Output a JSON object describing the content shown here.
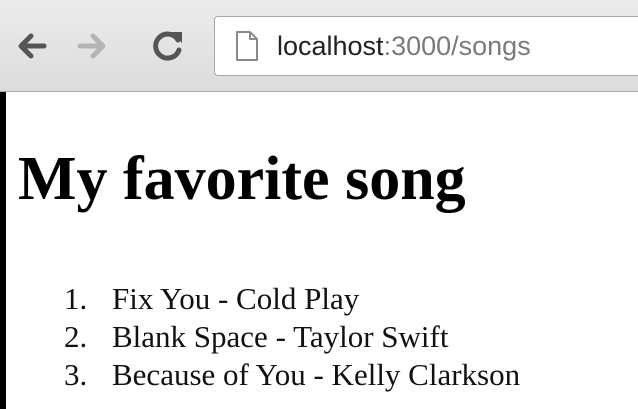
{
  "browser": {
    "url_host": "localhost",
    "url_path": ":3000/songs",
    "icons": {
      "back": "arrow-left-icon",
      "forward": "arrow-right-icon",
      "reload": "reload-icon",
      "page": "page-icon"
    },
    "colors": {
      "back_arrow": "#555555",
      "forward_arrow": "#b5b5b5",
      "reload": "#555555"
    }
  },
  "page": {
    "title": "My favorite song",
    "songs": [
      {
        "number": "1.",
        "text": "Fix You - Cold Play"
      },
      {
        "number": "2.",
        "text": "Blank Space - Taylor Swift"
      },
      {
        "number": "3.",
        "text": "Because of You - Kelly Clarkson"
      }
    ]
  }
}
